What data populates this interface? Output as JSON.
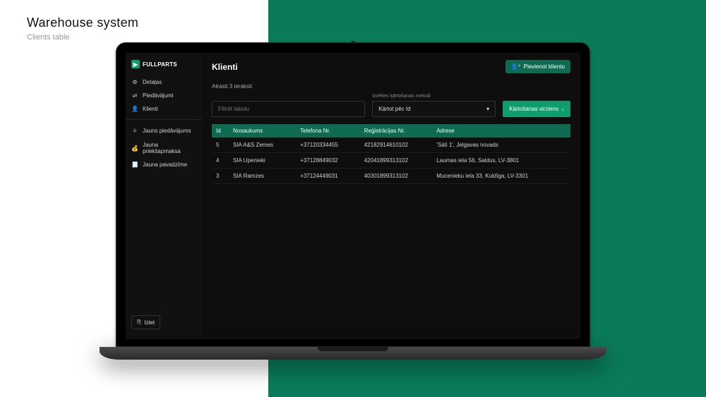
{
  "page_label": {
    "title": "Warehouse system",
    "subtitle": "Clients table"
  },
  "brand": "FULLPARTS",
  "sidebar": {
    "group_a": [
      {
        "icon": "⚙",
        "label": "Detaļas"
      },
      {
        "icon": "⇄",
        "label": "Piedāvājumi"
      },
      {
        "icon": "👤",
        "label": "Klienti"
      }
    ],
    "group_b": [
      {
        "icon": "＋",
        "label": "Jauns piedāvājums"
      },
      {
        "icon": "💰",
        "label": "Jauna priekšapmaksa"
      },
      {
        "icon": "🧾",
        "label": "Jauna pavadzīme"
      }
    ],
    "logout_label": "Iziet"
  },
  "header": {
    "title": "Klienti",
    "add_label": "Pievienot klientu"
  },
  "records_found": "Atrasti 3 ieraksti",
  "filter": {
    "placeholder": "Filtrēt tabulu"
  },
  "sort": {
    "label": "Izvēlies kārtošanas metodi",
    "selected": "Kārtot pēc Id",
    "direction_label": "Kārtošanas virziens"
  },
  "table": {
    "columns": [
      "Id",
      "Nosaukums",
      "Telefona Nr.",
      "Reģistrācijas Nr.",
      "Adrese"
    ],
    "rows": [
      {
        "id": "5",
        "name": "SIA A&S Zemes",
        "phone": "+37120334455",
        "reg": "42182914610102",
        "address": "'Sāti 1', Jelgavas novads"
      },
      {
        "id": "4",
        "name": "SIA Upenieki",
        "phone": "+37128849032",
        "reg": "42041899313102",
        "address": "Laumas iela 56, Saldus, LV-3801"
      },
      {
        "id": "3",
        "name": "SIA Ramzes",
        "phone": "+37124449031",
        "reg": "40301899313102",
        "address": "Mucenieku iela 33, Kuldīga, LV-3301"
      }
    ]
  }
}
